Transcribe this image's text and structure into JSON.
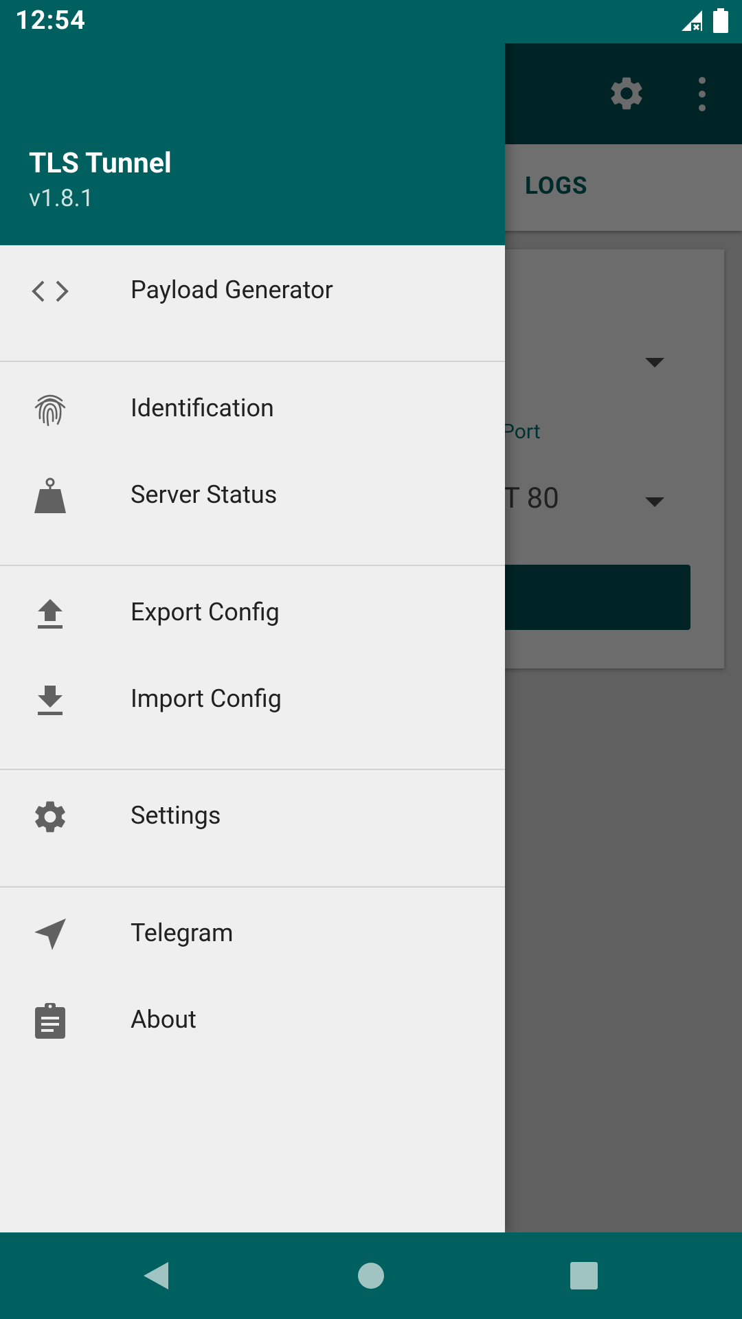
{
  "status_bar": {
    "time": "12:54"
  },
  "background_app": {
    "tab_label": "LOGS",
    "port_label": "Port",
    "port_value": "T 80"
  },
  "drawer": {
    "title": "TLS Tunnel",
    "version": "v1.8.1",
    "items": [
      {
        "label": "Payload Generator",
        "icon": "code-icon"
      },
      {
        "label": "Identification",
        "icon": "fingerprint-icon"
      },
      {
        "label": "Server Status",
        "icon": "weight-icon"
      },
      {
        "label": "Export Config",
        "icon": "upload-icon"
      },
      {
        "label": "Import Config",
        "icon": "download-icon"
      },
      {
        "label": "Settings",
        "icon": "gear-icon"
      },
      {
        "label": "Telegram",
        "icon": "send-icon"
      },
      {
        "label": "About",
        "icon": "clipboard-icon"
      }
    ]
  },
  "colors": {
    "primary": "#005f5f",
    "primary_dark": "#002425",
    "drawer_bg": "#efefef",
    "icon_gray": "#616161"
  }
}
